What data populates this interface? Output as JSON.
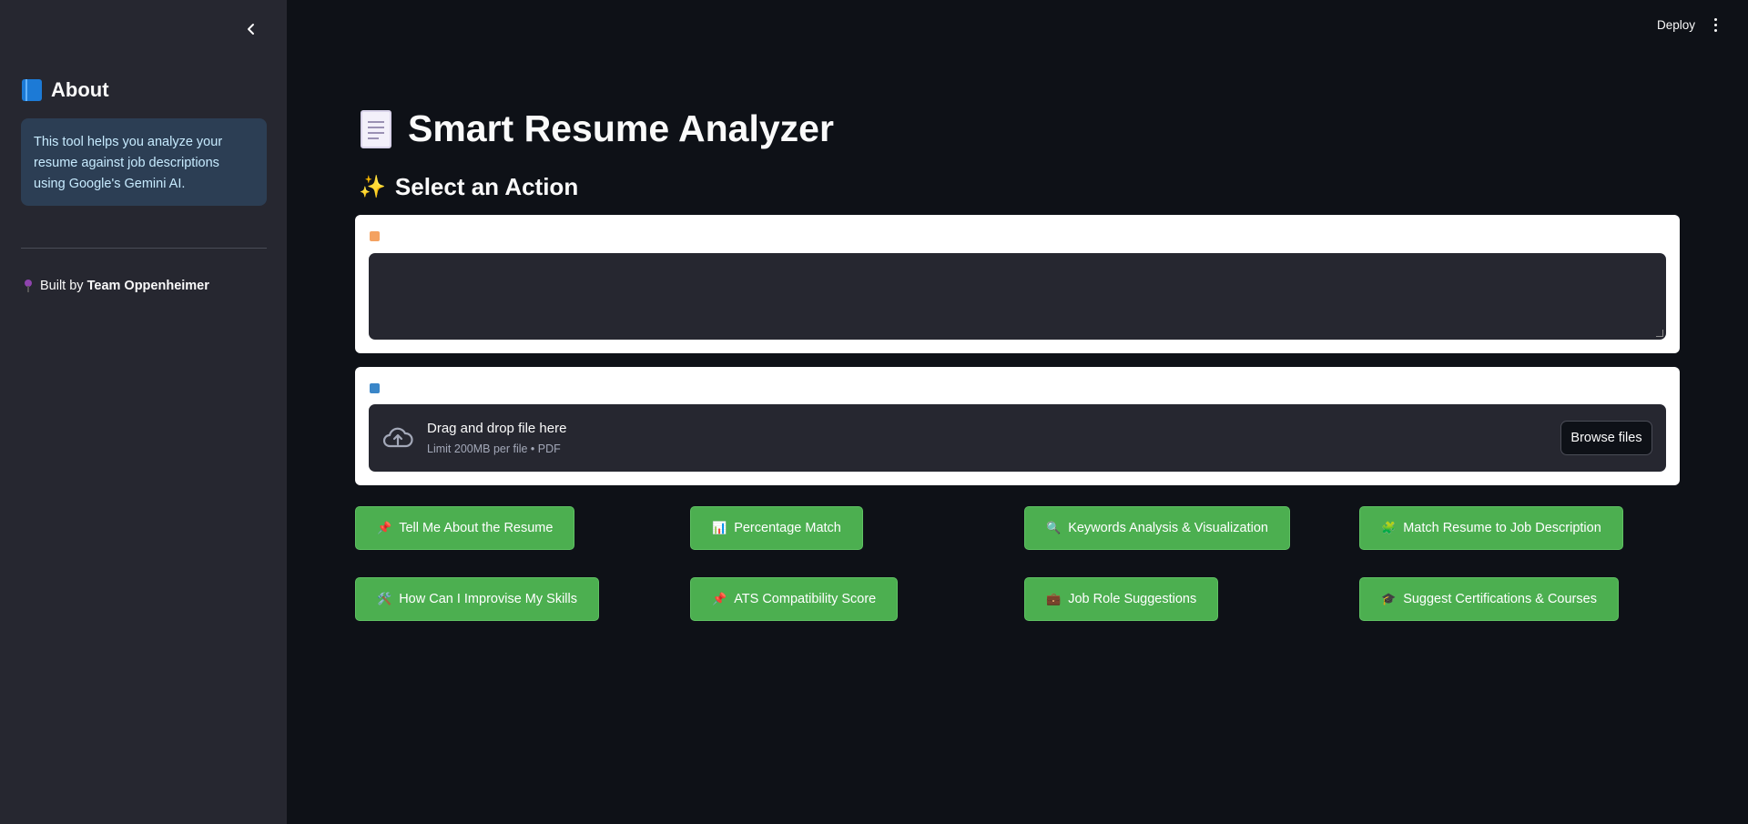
{
  "sidebar": {
    "collapse_icon": "chevron-left-icon",
    "about_title": "About",
    "about_icon": "book-icon",
    "info_text": "This tool helps you analyze your resume against job descriptions using Google's Gemini AI.",
    "built_by_prefix": "Built by",
    "team_name": "Team Oppenheimer",
    "built_by_icon": "pin-icon"
  },
  "header": {
    "deploy_label": "Deploy",
    "menu_icon": "more-vertical-icon"
  },
  "main": {
    "title": "Smart Resume Analyzer",
    "title_icon": "document-icon",
    "section_title": "Select an Action",
    "section_icon": "sparkles-icon",
    "jd_field": {
      "icon": "memo-icon",
      "value": ""
    },
    "uploader": {
      "icon": "inbox-tray-icon",
      "drop_title": "Drag and drop file here",
      "drop_limit": "Limit 200MB per file • PDF",
      "browse_label": "Browse files"
    }
  },
  "actions": [
    {
      "icon": "📌",
      "label": "Tell Me About the Resume"
    },
    {
      "icon": "📊",
      "label": "Percentage Match"
    },
    {
      "icon": "🔍",
      "label": "Keywords Analysis & Visualization"
    },
    {
      "icon": "🧩",
      "label": "Match Resume to Job Description"
    },
    {
      "icon": "🛠️",
      "label": "How Can I Improvise My Skills"
    },
    {
      "icon": "📌",
      "label": "ATS Compatibility Score"
    },
    {
      "icon": "💼",
      "label": "Job Role Suggestions"
    },
    {
      "icon": "🎓",
      "label": "Suggest Certifications & Courses"
    }
  ],
  "colors": {
    "background": "#0e1117",
    "sidebar": "#262730",
    "button": "#4caf50",
    "info_box": "#2c3e54"
  }
}
